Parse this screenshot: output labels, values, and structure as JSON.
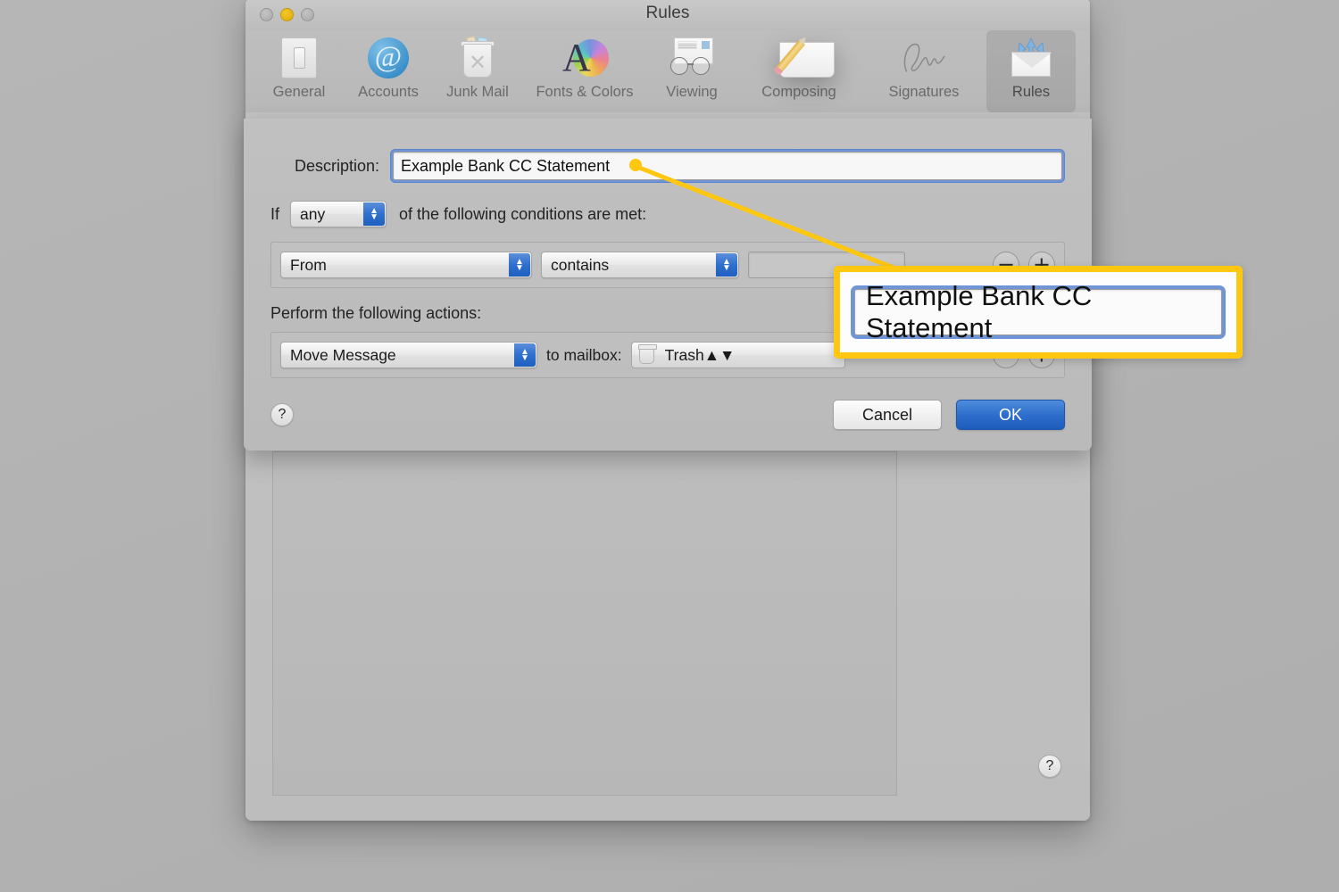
{
  "window": {
    "title": "Rules",
    "traffic_lights": [
      "close",
      "minimize",
      "zoom"
    ]
  },
  "toolbar": {
    "items": [
      {
        "label": "General",
        "icon": "general-icon"
      },
      {
        "label": "Accounts",
        "icon": "accounts-at-icon"
      },
      {
        "label": "Junk Mail",
        "icon": "junk-mail-trash-icon"
      },
      {
        "label": "Fonts & Colors",
        "icon": "fonts-colors-icon"
      },
      {
        "label": "Viewing",
        "icon": "viewing-glasses-icon"
      },
      {
        "label": "Composing",
        "icon": "composing-pencil-icon"
      },
      {
        "label": "Signatures",
        "icon": "signature-icon"
      },
      {
        "label": "Rules",
        "icon": "rules-envelope-icon"
      }
    ],
    "selected": "Rules"
  },
  "sheet": {
    "description_label": "Description:",
    "description_value": "Example Bank CC Statement",
    "description_placeholder": "",
    "if_label": "If",
    "match_mode": "any",
    "match_mode_tail": "of the following conditions are met:",
    "condition": {
      "header_field": "From",
      "operator": "contains",
      "value": "",
      "value_placeholder": "",
      "remove_label": "−",
      "add_label": "+"
    },
    "actions_label": "Perform the following actions:",
    "action": {
      "type": "Move Message",
      "to_mailbox_label": "to mailbox:",
      "mailbox": "Trash",
      "mailbox_icon": "trash-icon",
      "remove_label": "−",
      "add_label": "+"
    },
    "help_label": "?",
    "cancel_label": "Cancel",
    "ok_label": "OK"
  },
  "window_help_label": "?",
  "annotation": {
    "callout_text": "Example Bank CC Statement",
    "highlight_color": "#ffc710"
  }
}
